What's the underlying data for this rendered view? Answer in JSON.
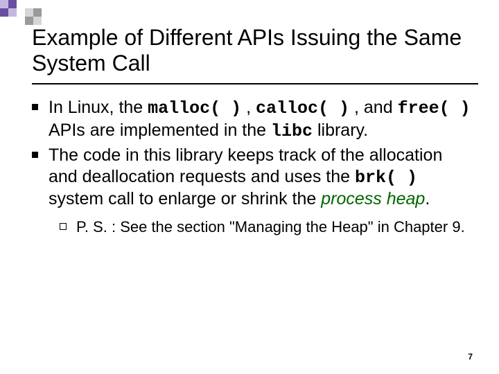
{
  "title": "Example of Different APIs Issuing the Same System Call",
  "bullets": [
    {
      "pre1": "In Linux, the ",
      "code1": "malloc( )",
      "mid1": " , ",
      "code2": "calloc( )",
      "mid2": " , and ",
      "code3": "free( )",
      "mid3": " APIs are implemented in the ",
      "code4": "libc",
      "post": " library."
    },
    {
      "pre1": "The code in this library keeps track of the allocation and deallocation requests and uses the ",
      "code1": "brk( )",
      "mid1": " system call to enlarge or shrink the ",
      "emph": "process heap",
      "post": "."
    }
  ],
  "sub": {
    "label": "P. S. : ",
    "text": "See the section \"Managing the Heap\" in Chapter 9."
  },
  "page": "7",
  "colors": {
    "purple_dark": "#6a4fa0",
    "purple_light": "#c5b8e0",
    "gray_dark": "#9a9a9a",
    "gray_light": "#d6d6d6"
  }
}
